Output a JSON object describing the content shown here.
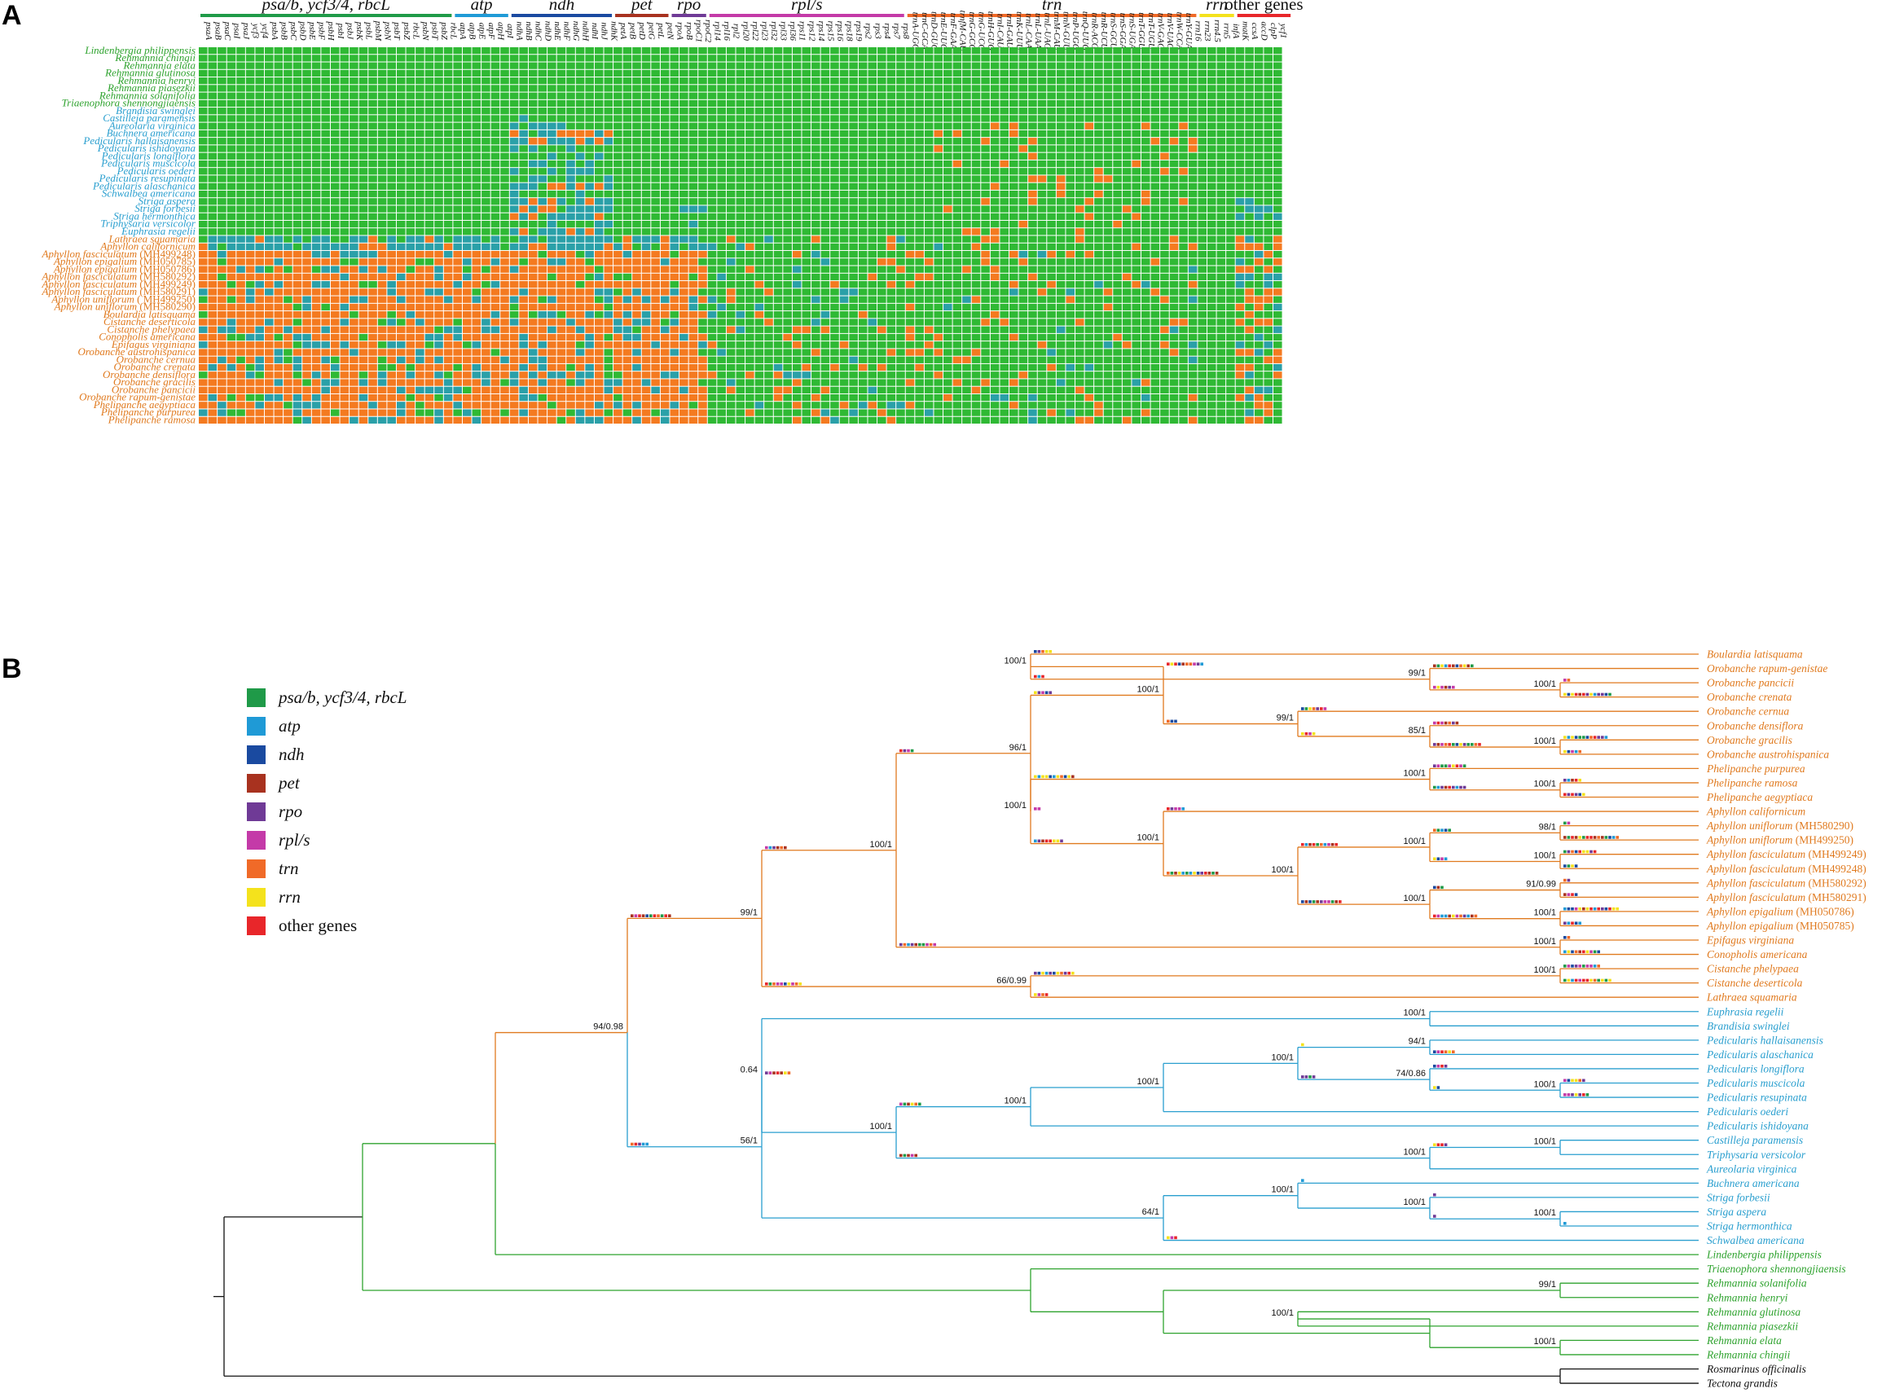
{
  "panels": {
    "a": "A",
    "b": "B"
  },
  "colors": {
    "present": "#2fb934",
    "pseudo": "#2aa0a8",
    "absent": "#f47a20",
    "green_taxa": "#2fa32f",
    "blue_taxa": "#2a9fcf",
    "orange_taxa": "#e07a1f",
    "black": "#111111"
  },
  "groups": [
    {
      "label": "psa/b, ycf3/4, rbcL",
      "color": "#1f9a48",
      "span": [
        0,
        26
      ],
      "italic": true
    },
    {
      "label": "atp",
      "color": "#1f9ad6",
      "span": [
        27,
        32
      ],
      "italic": true
    },
    {
      "label": "ndh",
      "color": "#1a4aa0",
      "span": [
        33,
        43
      ],
      "italic": true
    },
    {
      "label": "pet",
      "color": "#a8321f",
      "span": [
        44,
        49
      ],
      "italic": true
    },
    {
      "label": "rpo",
      "color": "#6f3a96",
      "span": [
        50,
        53
      ],
      "italic": true
    },
    {
      "label": "rpl/s",
      "color": "#c43aa8",
      "span": [
        54,
        74
      ],
      "italic": true
    },
    {
      "label": "trn",
      "color": "#f06a28",
      "span": [
        75,
        105
      ],
      "italic": true
    },
    {
      "label": "rrn",
      "color": "#f4e21c",
      "span": [
        106,
        109
      ],
      "italic": true
    },
    {
      "label": "other genes",
      "color": "#e8262a",
      "span": [
        110,
        115
      ],
      "italic": false
    }
  ],
  "genes": [
    "psaA",
    "psaB",
    "psaC",
    "psaI",
    "psaJ",
    "ycf3",
    "ycf4",
    "psbA",
    "psbB",
    "psbC",
    "psbD",
    "psbE",
    "psbF",
    "psbH",
    "psbI",
    "psbJ",
    "psbK",
    "psbL",
    "psbM",
    "psbN",
    "psbT",
    "psbZ",
    "rbcL",
    "psbN",
    "psbT",
    "psbZ",
    "rbcL",
    "atpA",
    "atpB",
    "atpE",
    "atpF",
    "atpH",
    "atpI",
    "ndhA",
    "ndhB",
    "ndhC",
    "ndhD",
    "ndhE",
    "ndhF",
    "ndhG",
    "ndhH",
    "ndhI",
    "ndhJ",
    "ndhK",
    "petA",
    "petB",
    "petD",
    "petG",
    "petL",
    "petN",
    "rpoA",
    "rpoB",
    "rpoC1",
    "rpoC2",
    "rpl14",
    "rpl16",
    "rpl2",
    "rpl20",
    "rpl22",
    "rpl23",
    "rpl32",
    "rpl33",
    "rpl36",
    "rps11",
    "rps12",
    "rps14",
    "rps15",
    "rps16",
    "rps18",
    "rps19",
    "rps2",
    "rps3",
    "rps4",
    "rps7",
    "rps8",
    "trnA-UGC",
    "trnC-GCA",
    "trnD-GUC",
    "trnE-UUC",
    "trnF-GAA",
    "trnfM-CAU",
    "trnG-GCC",
    "trnG-UCC",
    "trnH-GUG",
    "trnI-CAU",
    "trnI-GAU",
    "trnK-UUU",
    "trnL-CAA",
    "trnL-UAA",
    "trnL-UAG",
    "trnM-CAU",
    "trnN-GUU",
    "trnP-UGG",
    "trnQ-UUG",
    "trnR-ACG",
    "trnR-UCU",
    "trnS-GCU",
    "trnS-GGA",
    "trnS-UGA",
    "trnT-GGU",
    "trnT-UGU",
    "trnV-GAC",
    "trnV-UAC",
    "trnW-CCA",
    "trnY-GUA",
    "rrn16",
    "rrn23",
    "rrn4.5",
    "rrn5",
    "infA",
    "matK",
    "ccsA",
    "accD",
    "clpP",
    "ycf1"
  ],
  "species": [
    {
      "name": "Lindenbergia philippensis",
      "acc": "",
      "col": "g"
    },
    {
      "name": "Rehmannia chingii",
      "acc": "",
      "col": "g"
    },
    {
      "name": "Rehmannia elata",
      "acc": "",
      "col": "g"
    },
    {
      "name": "Rehmannia glutinosa",
      "acc": "",
      "col": "g"
    },
    {
      "name": "Rehmannia henryi",
      "acc": "",
      "col": "g"
    },
    {
      "name": "Rehmannia piasezkii",
      "acc": "",
      "col": "g"
    },
    {
      "name": "Rehmannia solanifolia",
      "acc": "",
      "col": "g"
    },
    {
      "name": "Triaenophora shennongjiaensis",
      "acc": "",
      "col": "g"
    },
    {
      "name": "Brandisia swinglei",
      "acc": "",
      "col": "b"
    },
    {
      "name": "Castilleja paramensis",
      "acc": "",
      "col": "b"
    },
    {
      "name": "Aureolaria virginica",
      "acc": "",
      "col": "b"
    },
    {
      "name": "Buchnera americana",
      "acc": "",
      "col": "b"
    },
    {
      "name": "Pedicularis hallaisanensis",
      "acc": "",
      "col": "b"
    },
    {
      "name": "Pedicularis ishidoyana",
      "acc": "",
      "col": "b"
    },
    {
      "name": "Pedicularis longiflora",
      "acc": "",
      "col": "b"
    },
    {
      "name": "Pedicularis muscicola",
      "acc": "",
      "col": "b"
    },
    {
      "name": "Pedicularis oederi",
      "acc": "",
      "col": "b"
    },
    {
      "name": "Pedicularis resupinata",
      "acc": "",
      "col": "b"
    },
    {
      "name": "Pedicularis alaschanica",
      "acc": "",
      "col": "b"
    },
    {
      "name": "Schwalbea americana",
      "acc": "",
      "col": "b"
    },
    {
      "name": "Striga aspera",
      "acc": "",
      "col": "b"
    },
    {
      "name": "Striga forbesii",
      "acc": "",
      "col": "b"
    },
    {
      "name": "Striga hermonthica",
      "acc": "",
      "col": "b"
    },
    {
      "name": "Triphysaria versicolor",
      "acc": "",
      "col": "b"
    },
    {
      "name": "Euphrasia regelii",
      "acc": "",
      "col": "b"
    },
    {
      "name": "Lathraea squamaria",
      "acc": "",
      "col": "o"
    },
    {
      "name": "Aphyllon californicum",
      "acc": "",
      "col": "o"
    },
    {
      "name": "Aphyllon fasciculatum",
      "acc": "(MH499248)",
      "col": "o"
    },
    {
      "name": "Aphyllon epigalium",
      "acc": "(MH050785)",
      "col": "o"
    },
    {
      "name": "Aphyllon epigalium",
      "acc": "(MH050786)",
      "col": "o"
    },
    {
      "name": "Aphyllon fasciculatum",
      "acc": "(MH580292)",
      "col": "o"
    },
    {
      "name": "Aphyllon fasciculatum",
      "acc": "(MH499249)",
      "col": "o"
    },
    {
      "name": "Aphyllon fasciculatum",
      "acc": "(MH580291)",
      "col": "o"
    },
    {
      "name": "Aphyllon uniflorum",
      "acc": "( MH499250)",
      "col": "o"
    },
    {
      "name": "Aphyllon uniflorum",
      "acc": "(MH580290)",
      "col": "o"
    },
    {
      "name": "Boulardia latisquama",
      "acc": "",
      "col": "o"
    },
    {
      "name": "Cistanche deserticola",
      "acc": "",
      "col": "o"
    },
    {
      "name": "Cistanche phelypaea",
      "acc": "",
      "col": "o"
    },
    {
      "name": "Conopholis americana",
      "acc": "",
      "col": "o"
    },
    {
      "name": "Epifagus virginiana",
      "acc": "",
      "col": "o"
    },
    {
      "name": "Orobanche austrohispanica",
      "acc": "",
      "col": "o"
    },
    {
      "name": "Orobanche cernua",
      "acc": "",
      "col": "o"
    },
    {
      "name": "Orobanche crenata",
      "acc": "",
      "col": "o"
    },
    {
      "name": "Orobanche densiflora",
      "acc": "",
      "col": "o"
    },
    {
      "name": "Orobanche gracilis",
      "acc": "",
      "col": "o"
    },
    {
      "name": "Orobanche pancicii",
      "acc": "",
      "col": "o"
    },
    {
      "name": "Orobanche rapum-genistae",
      "acc": "",
      "col": "o"
    },
    {
      "name": "Phelipanche aegyptiaca",
      "acc": "",
      "col": "o"
    },
    {
      "name": "Phelipanche purpurea",
      "acc": "",
      "col": "o"
    },
    {
      "name": "Phelipanche ramosa",
      "acc": "",
      "col": "o"
    }
  ],
  "legend": [
    {
      "label": "psa/b, ycf3/4, rbcL",
      "color": "#1f9a48",
      "italic": true
    },
    {
      "label": "atp",
      "color": "#1f9ad6",
      "italic": true
    },
    {
      "label": "ndh",
      "color": "#1a4aa0",
      "italic": true
    },
    {
      "label": "pet",
      "color": "#a8321f",
      "italic": true
    },
    {
      "label": "rpo",
      "color": "#6f3a96",
      "italic": true
    },
    {
      "label": "rpl/s",
      "color": "#c43aa8",
      "italic": true
    },
    {
      "label": "trn",
      "color": "#f06a28",
      "italic": true
    },
    {
      "label": "rrn",
      "color": "#f4e21c",
      "italic": true
    },
    {
      "label": "other genes",
      "color": "#e8262a",
      "italic": false
    }
  ],
  "tree_tips": [
    {
      "name": "Boulardia latisquama",
      "acc": "",
      "col": "o"
    },
    {
      "name": "Orobanche rapum-genistae",
      "acc": "",
      "col": "o"
    },
    {
      "name": "Orobanche pancicii",
      "acc": "",
      "col": "o"
    },
    {
      "name": "Orobanche crenata",
      "acc": "",
      "col": "o"
    },
    {
      "name": "Orobanche cernua",
      "acc": "",
      "col": "o"
    },
    {
      "name": "Orobanche densiflora",
      "acc": "",
      "col": "o"
    },
    {
      "name": "Orobanche gracilis",
      "acc": "",
      "col": "o"
    },
    {
      "name": "Orobanche austrohispanica",
      "acc": "",
      "col": "o"
    },
    {
      "name": "Phelipanche purpurea",
      "acc": "",
      "col": "o"
    },
    {
      "name": "Phelipanche ramosa",
      "acc": "",
      "col": "o"
    },
    {
      "name": "Phelipanche aegyptiaca",
      "acc": "",
      "col": "o"
    },
    {
      "name": "Aphyllon californicum",
      "acc": "",
      "col": "o"
    },
    {
      "name": "Aphyllon uniflorum",
      "acc": "(MH580290)",
      "col": "o"
    },
    {
      "name": "Aphyllon uniflorum",
      "acc": "(MH499250)",
      "col": "o"
    },
    {
      "name": "Aphyllon fasciculatum",
      "acc": "(MH499249)",
      "col": "o"
    },
    {
      "name": "Aphyllon fasciculatum",
      "acc": "(MH499248)",
      "col": "o"
    },
    {
      "name": "Aphyllon fasciculatum",
      "acc": "(MH580292)",
      "col": "o"
    },
    {
      "name": "Aphyllon fasciculatum",
      "acc": "(MH580291)",
      "col": "o"
    },
    {
      "name": "Aphyllon epigalium",
      "acc": "(MH050786)",
      "col": "o"
    },
    {
      "name": "Aphyllon epigalium",
      "acc": "(MH050785)",
      "col": "o"
    },
    {
      "name": "Epifagus virginiana",
      "acc": "",
      "col": "o"
    },
    {
      "name": "Conopholis americana",
      "acc": "",
      "col": "o"
    },
    {
      "name": "Cistanche phelypaea",
      "acc": "",
      "col": "o"
    },
    {
      "name": "Cistanche deserticola",
      "acc": "",
      "col": "o"
    },
    {
      "name": "Lathraea squamaria",
      "acc": "",
      "col": "o"
    },
    {
      "name": "Euphrasia regelii",
      "acc": "",
      "col": "b"
    },
    {
      "name": "Brandisia swinglei",
      "acc": "",
      "col": "b"
    },
    {
      "name": "Pedicularis hallaisanensis",
      "acc": "",
      "col": "b"
    },
    {
      "name": "Pedicularis alaschanica",
      "acc": "",
      "col": "b"
    },
    {
      "name": "Pedicularis longiflora",
      "acc": "",
      "col": "b"
    },
    {
      "name": "Pedicularis muscicola",
      "acc": "",
      "col": "b"
    },
    {
      "name": "Pedicularis resupinata",
      "acc": "",
      "col": "b"
    },
    {
      "name": "Pedicularis oederi",
      "acc": "",
      "col": "b"
    },
    {
      "name": "Pedicularis ishidoyana",
      "acc": "",
      "col": "b"
    },
    {
      "name": "Castilleja paramensis",
      "acc": "",
      "col": "b"
    },
    {
      "name": "Triphysaria versicolor",
      "acc": "",
      "col": "b"
    },
    {
      "name": "Aureolaria virginica",
      "acc": "",
      "col": "b"
    },
    {
      "name": "Buchnera americana",
      "acc": "",
      "col": "b"
    },
    {
      "name": "Striga forbesii",
      "acc": "",
      "col": "b"
    },
    {
      "name": "Striga aspera",
      "acc": "",
      "col": "b"
    },
    {
      "name": "Striga hermonthica",
      "acc": "",
      "col": "b"
    },
    {
      "name": "Schwalbea americana",
      "acc": "",
      "col": "b"
    },
    {
      "name": "Lindenbergia philippensis",
      "acc": "",
      "col": "g"
    },
    {
      "name": "Triaenophora shennongjiaensis",
      "acc": "",
      "col": "g"
    },
    {
      "name": "Rehmannia solanifolia",
      "acc": "",
      "col": "g"
    },
    {
      "name": "Rehmannia henryi",
      "acc": "",
      "col": "g"
    },
    {
      "name": "Rehmannia glutinosa",
      "acc": "",
      "col": "g"
    },
    {
      "name": "Rehmannia piasezkii",
      "acc": "",
      "col": "g"
    },
    {
      "name": "Rehmannia elata",
      "acc": "",
      "col": "g"
    },
    {
      "name": "Rehmannia chingii",
      "acc": "",
      "col": "g"
    },
    {
      "name": "Rosmarinus officinalis",
      "acc": "",
      "col": "k"
    },
    {
      "name": "Tectona grandis",
      "acc": "",
      "col": "k"
    }
  ],
  "support_values": [
    "100/1",
    "99/1",
    "100/1",
    "100/1",
    "85/1",
    "99/1",
    "100/1",
    "100/1",
    "100/1",
    "98/1",
    "100/1",
    "100/1",
    "91/0.99",
    "100/1",
    "100/1",
    "100/1",
    "100/1",
    "100/1",
    "96/1",
    "100/1",
    "100/1",
    "100/1",
    "66/0.99",
    "99/1",
    "100/1",
    "94/1",
    "100/1",
    "74/0.86",
    "100/1",
    "100/1",
    "100/1",
    "100/1",
    "100/1",
    "100/1",
    "0.64",
    "100/1",
    "100/1",
    "100/1",
    "64/1",
    "56/1",
    "94/0.98",
    "99/1",
    "100/1",
    "100/1"
  ]
}
